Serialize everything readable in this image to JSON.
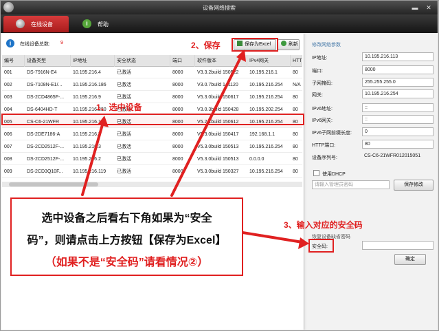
{
  "window": {
    "title": "设备网络搜索",
    "minimize": "▬",
    "close": "✕"
  },
  "tabs": [
    {
      "label": "在线设备"
    },
    {
      "label": "帮助"
    }
  ],
  "toolbar": {
    "online_label": "在线设备总数:",
    "online_count": "9",
    "save_excel": "保存为Excel",
    "refresh": "刷新"
  },
  "table": {
    "headers": [
      "编号",
      "设备类型",
      "IP地址",
      "安全状态",
      "端口",
      "软件版本",
      "IPv4网关",
      "HTT"
    ],
    "rows": [
      [
        "001",
        "DS-7916N-E4",
        "10.195.216.4",
        "已激活",
        "8000",
        "V3.3.2build 150522",
        "10.195.216.1",
        "80"
      ],
      [
        "002",
        "DS-7108N-E1/...",
        "10.195.216.186",
        "已激活",
        "8000",
        "V3.0.7build 141120",
        "10.195.216.254",
        "N/A"
      ],
      [
        "003",
        "DS-2CD4865F-...",
        "10.195.216.9",
        "已激活",
        "8000",
        "V5.3.0build 150617",
        "10.195.216.254",
        "80"
      ],
      [
        "004",
        "DS-6404HD-T",
        "10.195.216.230",
        "已激活",
        "8000",
        "V3.0.3build 150428",
        "10.195.202.254",
        "80"
      ],
      [
        "005",
        "CS-C6-21WFR",
        "10.195.216.113",
        "已激活",
        "8000",
        "V5.2.1build 150612",
        "10.195.216.254",
        "80"
      ],
      [
        "006",
        "DS-2DE7186-A",
        "10.195.216.7",
        "已激活",
        "8000",
        "V5.3.0build 150417",
        "192.168.1.1",
        "80"
      ],
      [
        "007",
        "DS-2CD2512F-...",
        "10.195.216.3",
        "已激活",
        "8000",
        "V5.3.0build 150513",
        "10.195.216.254",
        "80"
      ],
      [
        "008",
        "DS-2CD2512F-...",
        "10.195.216.2",
        "已激活",
        "8000",
        "V5.3.0build 150513",
        "0.0.0.0",
        "80"
      ],
      [
        "009",
        "DS-2CD3Q10F...",
        "10.195.216.119",
        "已激活",
        "8000",
        "V5.3.0build 150327",
        "10.195.216.254",
        "80"
      ]
    ]
  },
  "params": {
    "title": "修改网络参数",
    "ip_label": "IP地址:",
    "ip": "10.195.216.113",
    "port_label": "端口:",
    "port": "8000",
    "mask_label": "子网掩码:",
    "mask": "255.255.255.0",
    "gateway_label": "网关:",
    "gateway": "10.195.216.254",
    "ipv6_label": "IPv6地址:",
    "ipv6": "::",
    "ipv6gw_label": "IPv6网关:",
    "ipv6gw": "::",
    "ipv6prefix_label": "IPv6子网前缀长度:",
    "ipv6prefix": "0",
    "http_label": "HTTP端口:",
    "http": "80",
    "serial_label": "设备序列号:",
    "serial": "CS-C6-21WFR012015051",
    "dhcp_label": "使用DHCP",
    "admin_placeholder": "请输入管理员密码",
    "save_btn": "保存修改",
    "security_title": "恢复设备缺省密码",
    "security_label": "安全码:",
    "confirm_btn": "确定"
  },
  "annotations": {
    "step1": "1、选中设备",
    "step2": "2、保存",
    "step3": "3、输入对应的安全码",
    "callout_line1": "选中设备之后看右下角如果为“安全",
    "callout_line2": "码”，则请点击上方按钮【保存为Excel】",
    "callout_line3": "（如果不是“安全码”请看情况②）"
  },
  "colors": {
    "accent_red": "#e02020",
    "tab_red": "#c52b2b",
    "info_blue": "#1e74c8"
  }
}
